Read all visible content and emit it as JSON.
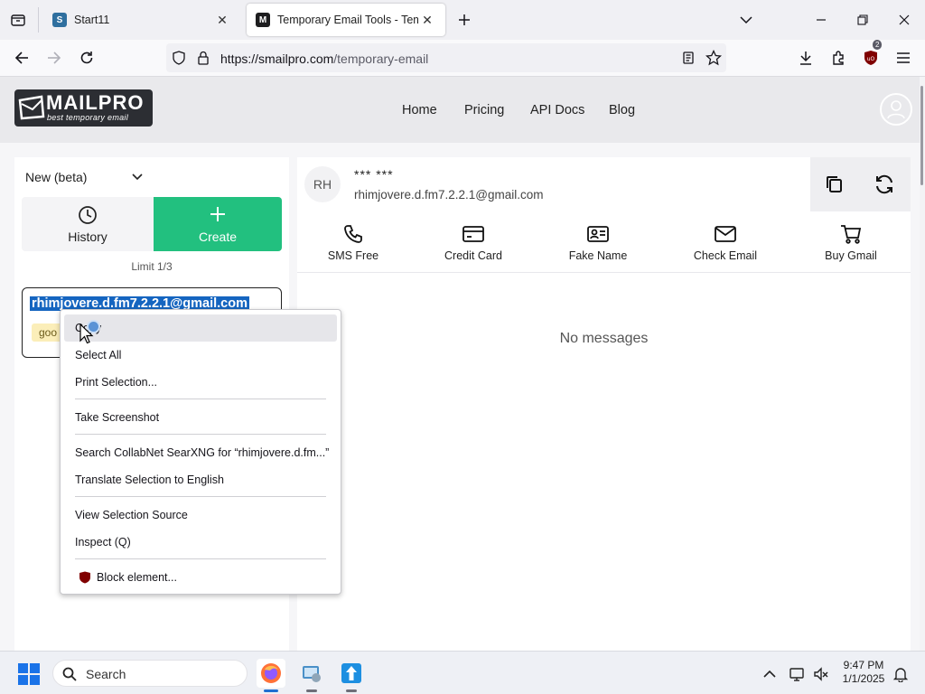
{
  "browser": {
    "tabs": [
      {
        "title": "Start11",
        "favicon": "S"
      },
      {
        "title": "Temporary Email Tools - Temp",
        "favicon": "M"
      }
    ],
    "url_host": "https://smailpro.com",
    "url_path": "/temporary-email",
    "extension_badge": "2"
  },
  "site": {
    "logo_name": "MAILPRO",
    "logo_tagline": "best temporary email",
    "nav": [
      "Home",
      "Pricing",
      "API Docs",
      "Blog"
    ]
  },
  "left_panel": {
    "dropdown_value": "New (beta)",
    "history_label": "History",
    "create_label": "Create",
    "limit_text": "Limit 1/3",
    "selected_email": "rhimjovere.d.fm7.2.2.1@gmail.com",
    "email_tag": "goo"
  },
  "right_panel": {
    "avatar_initials": "RH",
    "name_masked": "*** ***",
    "email": "rhimjovere.d.fm7.2.2.1@gmail.com",
    "services": [
      "SMS Free",
      "Credit Card",
      "Fake Name",
      "Check Email",
      "Buy Gmail"
    ],
    "empty_state": "No messages"
  },
  "context_menu": {
    "items": {
      "copy": "Copy",
      "select_all": "Select All",
      "print_selection": "Print Selection...",
      "take_screenshot": "Take Screenshot",
      "search": "Search CollabNet SearXNG for “rhimjovere.d.fm...”",
      "translate": "Translate Selection to English",
      "view_source": "View Selection Source",
      "inspect": "Inspect (Q)",
      "block_element": "Block element..."
    }
  },
  "taskbar": {
    "search_placeholder": "Search",
    "time": "9:47 PM",
    "date": "1/1/2025"
  },
  "colors": {
    "accent_green": "#22c07f",
    "selection_blue": "#1565c0",
    "logo_dark": "#2c2e33"
  }
}
